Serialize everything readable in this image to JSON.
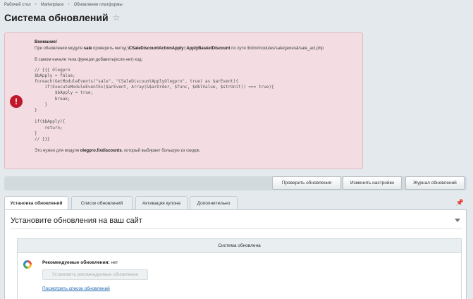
{
  "breadcrumb": [
    "Рабочий стол",
    "Marketplace",
    "Обновление платформы"
  ],
  "page_title": "Система обновлений",
  "alert": {
    "title": "Внимание!",
    "line1_pre": "При обновлении модуля ",
    "line1_module": "sale",
    "line1_mid": " проверить метод ",
    "line1_method": "\\CSaleDiscountActionApply::ApplyBasketDiscount",
    "line1_post": " по пути /bitrix/modules/sale/general/sale_act.php",
    "line2": "В самом начале тела функции добавить(если нет) код:",
    "code": "// {{{ Olegpro\n$bApply = false;\nforeach(GetModuleEvents(\"sale\", \"CSaleDiscountApplyOlegpro\", true) as $arEvent){\n    if(ExecuteModuleEventEx($arEvent, Array(&$arOrder, $func, $dblValue, $strUnit)) === true){\n        $bApply = true;\n        break;\n    }\n}\n\nif($bApply){\n    return;\n}\n// }}}",
    "outro_pre": "Это нужно для модуля ",
    "outro_module": "olegpro.fixdiscounts",
    "outro_post": ", который выбирает большую из скидок."
  },
  "toolbar": {
    "check": "Проверить обновления",
    "settings": "Изменить настройки",
    "log": "Журнал обновлений"
  },
  "tabs": [
    "Установка обновлений",
    "Список обновлений",
    "Активация купона",
    "Дополнительно"
  ],
  "content": {
    "title": "Установите обновления на ваш сайт",
    "panel_head": "Система обновлена",
    "rec_label": "Рекомендуемые обновления:",
    "rec_value": " нет",
    "install_button": "Установить рекомендуемые обновления",
    "list_link": "Посмотреть список обновлений"
  },
  "icons": {
    "star": "star-icon",
    "alert": "exclamation-icon",
    "pin": "pin-icon",
    "collapse": "chevron-down-icon",
    "update": "update-icon"
  }
}
